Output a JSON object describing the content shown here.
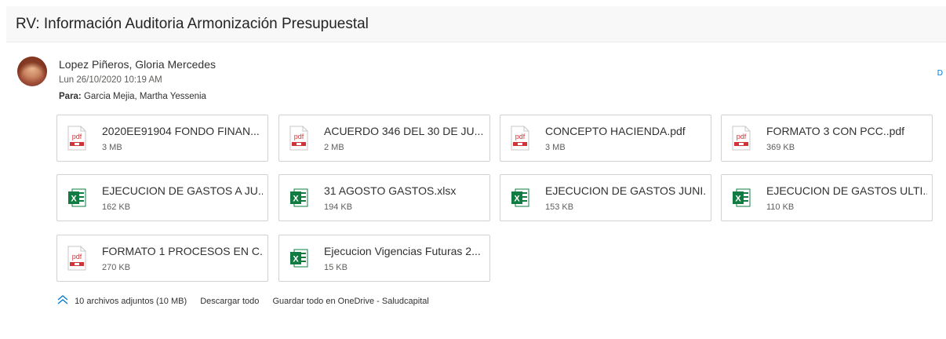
{
  "message": {
    "subject": "RV: Información Auditoria Armonización Presupuestal",
    "sender": "Lopez Piñeros, Gloria Mercedes",
    "date": "Lun 26/10/2020 10:19 AM",
    "to_label": "Para:",
    "to_value": "Garcia Mejia, Martha Yessenia",
    "edge_char": "D"
  },
  "attachments": [
    {
      "name": "2020EE91904 FONDO FINAN...",
      "size": "3 MB",
      "icon": "pdf-icon"
    },
    {
      "name": "ACUERDO 346 DEL 30 DE JU...",
      "size": "2 MB",
      "icon": "pdf-icon"
    },
    {
      "name": "CONCEPTO HACIENDA.pdf",
      "size": "3 MB",
      "icon": "pdf-icon"
    },
    {
      "name": "FORMATO 3 CON PCC..pdf",
      "size": "369 KB",
      "icon": "pdf-icon"
    },
    {
      "name": "EJECUCION DE GASTOS A JU...",
      "size": "162 KB",
      "icon": "excel-icon"
    },
    {
      "name": "31 AGOSTO GASTOS.xlsx",
      "size": "194 KB",
      "icon": "excel-icon"
    },
    {
      "name": "EJECUCION DE GASTOS JUNI...",
      "size": "153 KB",
      "icon": "excel-icon"
    },
    {
      "name": "EJECUCION DE GASTOS ULTI...",
      "size": "110 KB",
      "icon": "excel-icon"
    },
    {
      "name": "FORMATO 1 PROCESOS EN C...",
      "size": "270 KB",
      "icon": "pdf-icon"
    },
    {
      "name": "Ejecucion Vigencias Futuras 2...",
      "size": "15 KB",
      "icon": "excel-icon"
    }
  ],
  "footer": {
    "count": "10 archivos adjuntos (10 MB)",
    "download_all": "Descargar todo",
    "save_all": "Guardar todo en OneDrive - Saludcapital"
  },
  "icons": {
    "pdf_text": "pdf",
    "excel_text": "X"
  },
  "colors": {
    "pdf": "#d13438",
    "excel": "#107c41",
    "accent": "#0078d4"
  }
}
